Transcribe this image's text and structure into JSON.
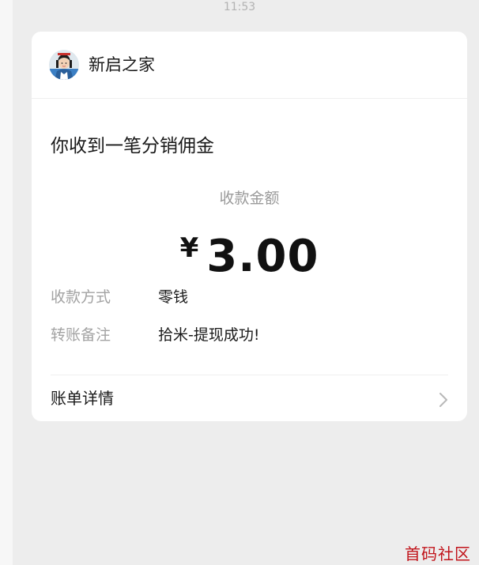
{
  "timestamp": "11:53",
  "card": {
    "sender_name": "新启之家",
    "avatar_icon": "sender-avatar",
    "notice_title": "你收到一笔分销佣金",
    "amount_label": "收款金额",
    "currency_symbol": "¥",
    "amount_value": "3.00",
    "rows": [
      {
        "label": "收款方式",
        "value": "零钱"
      },
      {
        "label": "转账备注",
        "value": "拾米-提现成功!"
      }
    ],
    "bill_detail_label": "账单详情",
    "bill_detail_icon": "chevron-right-icon"
  },
  "watermark": "首码社区",
  "colors": {
    "chat_background": "#ededed",
    "card_background": "#ffffff",
    "watermark": "#c1131a"
  }
}
